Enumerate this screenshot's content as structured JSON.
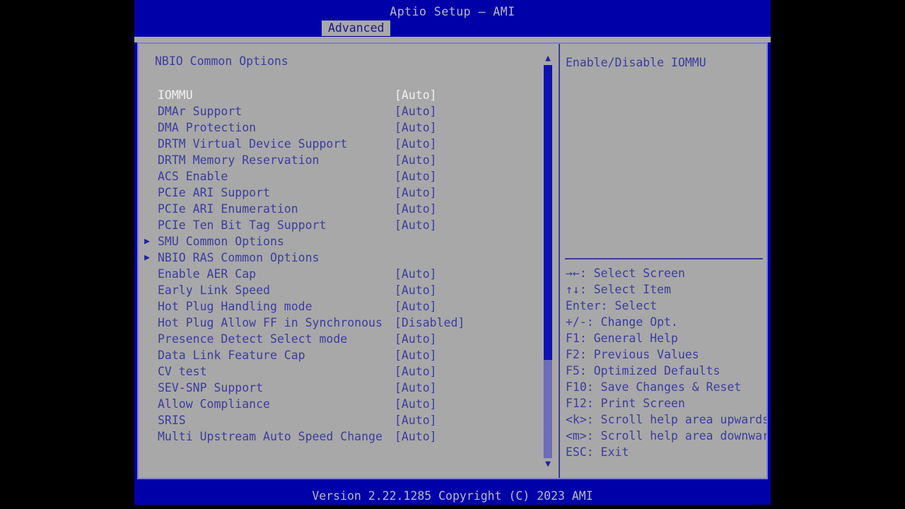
{
  "header": {
    "title": "Aptio Setup – AMI",
    "tabs": [
      {
        "label": "Advanced",
        "active": true
      }
    ]
  },
  "main": {
    "section_title": "NBIO Common Options",
    "rows": [
      {
        "label": "IOMMU",
        "value": "[Auto]",
        "submenu": false,
        "selected": true
      },
      {
        "label": "DMAr Support",
        "value": "[Auto]",
        "submenu": false,
        "selected": false
      },
      {
        "label": "DMA Protection",
        "value": "[Auto]",
        "submenu": false,
        "selected": false
      },
      {
        "label": "DRTM Virtual Device Support",
        "value": "[Auto]",
        "submenu": false,
        "selected": false
      },
      {
        "label": "DRTM Memory Reservation",
        "value": "[Auto]",
        "submenu": false,
        "selected": false
      },
      {
        "label": "ACS Enable",
        "value": "[Auto]",
        "submenu": false,
        "selected": false
      },
      {
        "label": "PCIe ARI Support",
        "value": "[Auto]",
        "submenu": false,
        "selected": false
      },
      {
        "label": "PCIe ARI Enumeration",
        "value": "[Auto]",
        "submenu": false,
        "selected": false
      },
      {
        "label": "PCIe Ten Bit Tag Support",
        "value": "[Auto]",
        "submenu": false,
        "selected": false
      },
      {
        "label": "SMU Common Options",
        "value": "",
        "submenu": true,
        "selected": false
      },
      {
        "label": "NBIO RAS Common Options",
        "value": "",
        "submenu": true,
        "selected": false
      },
      {
        "label": "Enable AER Cap",
        "value": "[Auto]",
        "submenu": false,
        "selected": false
      },
      {
        "label": "Early Link Speed",
        "value": "[Auto]",
        "submenu": false,
        "selected": false
      },
      {
        "label": "Hot Plug Handling mode",
        "value": "[Auto]",
        "submenu": false,
        "selected": false
      },
      {
        "label": "Hot Plug Allow FF in Synchronous",
        "value": "[Disabled]",
        "submenu": false,
        "selected": false
      },
      {
        "label": "Presence Detect Select mode",
        "value": "[Auto]",
        "submenu": false,
        "selected": false
      },
      {
        "label": "Data Link Feature Cap",
        "value": "[Auto]",
        "submenu": false,
        "selected": false
      },
      {
        "label": "CV test",
        "value": "[Auto]",
        "submenu": false,
        "selected": false
      },
      {
        "label": "SEV-SNP Support",
        "value": "[Auto]",
        "submenu": false,
        "selected": false
      },
      {
        "label": "Allow Compliance",
        "value": "[Auto]",
        "submenu": false,
        "selected": false
      },
      {
        "label": "SRIS",
        "value": "[Auto]",
        "submenu": false,
        "selected": false
      },
      {
        "label": "Multi Upstream Auto Speed Change",
        "value": "[Auto]",
        "submenu": false,
        "selected": false
      }
    ],
    "scrollbar": {
      "up_arrow": "▲",
      "down_arrow": "▼",
      "thumb_fraction": 0.75
    }
  },
  "help": {
    "description": "Enable/Disable IOMMU",
    "keys": [
      "→←: Select Screen",
      "↑↓: Select Item",
      "Enter: Select",
      "+/-: Change Opt.",
      "F1: General Help",
      "F2: Previous Values",
      "F5: Optimized Defaults",
      "F10: Save Changes & Reset",
      "F12: Print Screen",
      "<k>: Scroll help area upwards",
      "<m>: Scroll help area downwards",
      "ESC: Exit"
    ]
  },
  "footer": {
    "version": "Version 2.22.1285 Copyright (C) 2023 AMI"
  },
  "colors": {
    "background_blue": "#0000a8",
    "panel_gray": "#a8a8a8",
    "text_blue": "#3c3ca0",
    "selected_text": "#f0f0f0",
    "border": "#8080d0",
    "scroll_thumb": "#1010b0"
  }
}
